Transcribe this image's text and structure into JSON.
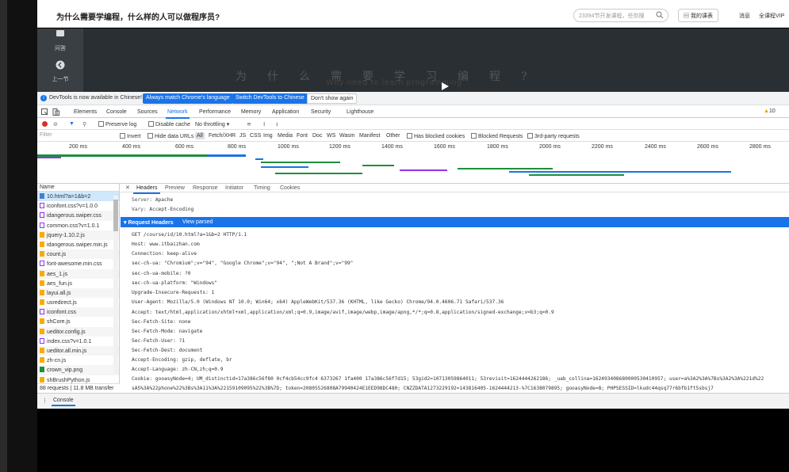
{
  "site": {
    "title": "为什么需要学编程，什么样的人可以做程序员?",
    "search_placeholder": "23394节开发课程，任你搜",
    "my_courses": "我的课表",
    "messages": "消息",
    "vip": "全课程VIP"
  },
  "video": {
    "side_items": [
      {
        "label": "问答",
        "icon": "qa-icon"
      },
      {
        "label": "上一节",
        "icon": "prev-icon"
      }
    ],
    "title_cn": "为什么需要学习编程?",
    "title_en": "Why need to learn programming"
  },
  "infobar": {
    "text": "DevTools is now available in Chinese!",
    "btn_match": "Always match Chrome's language",
    "btn_switch": "Switch DevTools to Chinese",
    "btn_dismiss": "Don't show again"
  },
  "devtools": {
    "tabs": [
      "Elements",
      "Console",
      "Sources",
      "Network",
      "Performance",
      "Memory",
      "Application",
      "Security",
      "Lighthouse"
    ],
    "active_tab": "Network",
    "warnings": "10"
  },
  "toolbar": {
    "preserve_log": "Preserve log",
    "disable_cache": "Disable cache",
    "throttling": "No throttling"
  },
  "filter": {
    "placeholder": "Filter",
    "invert": "Invert",
    "hide_data_urls": "Hide data URLs",
    "types": [
      "All",
      "Fetch/XHR",
      "JS",
      "CSS",
      "Img",
      "Media",
      "Font",
      "Doc",
      "WS",
      "Wasm",
      "Manifest",
      "Other"
    ],
    "has_blocked_cookies": "Has blocked cookies",
    "blocked_requests": "Blocked Requests",
    "third_party": "3rd-party requests"
  },
  "timeline": {
    "ticks": [
      "200 ms",
      "400 ms",
      "600 ms",
      "800 ms",
      "1000 ms",
      "1200 ms",
      "1400 ms",
      "1600 ms",
      "1800 ms",
      "2000 ms",
      "2200 ms",
      "2400 ms",
      "2600 ms",
      "2800 ms"
    ]
  },
  "requests": {
    "header": "Name",
    "rows": [
      {
        "name": "10.html?a=1&b=2",
        "kind": "doc"
      },
      {
        "name": "iconfont.css?v=1.0.0",
        "kind": "css"
      },
      {
        "name": "idangerous.swiper.css",
        "kind": "css"
      },
      {
        "name": "common.css?v=1.0.1",
        "kind": "css"
      },
      {
        "name": "jquery-1.10.2.js",
        "kind": "js"
      },
      {
        "name": "idangerous.swiper.min.js",
        "kind": "js"
      },
      {
        "name": "count.js",
        "kind": "js"
      },
      {
        "name": "font-awesome.min.css",
        "kind": "css"
      },
      {
        "name": "aes_1.js",
        "kind": "js"
      },
      {
        "name": "aes_fun.js",
        "kind": "js"
      },
      {
        "name": "layui.all.js",
        "kind": "js"
      },
      {
        "name": "usredirect.js",
        "kind": "js"
      },
      {
        "name": "iconfont.css",
        "kind": "css"
      },
      {
        "name": "shCore.js",
        "kind": "js"
      },
      {
        "name": "ueditor.config.js",
        "kind": "js"
      },
      {
        "name": "index.css?v=1.0.1",
        "kind": "css"
      },
      {
        "name": "ueditor.all.min.js",
        "kind": "js"
      },
      {
        "name": "zh-cn.js",
        "kind": "js"
      },
      {
        "name": "crown_vip.png",
        "kind": "img"
      },
      {
        "name": "shBrushPython.js",
        "kind": "js"
      }
    ],
    "summary": "88 requests | 11.8 MB transfer"
  },
  "details": {
    "tabs": [
      "Headers",
      "Preview",
      "Response",
      "Initiator",
      "Timing",
      "Cookies"
    ],
    "active": "Headers",
    "response_headers": [
      {
        "k": "Server:",
        "v": "Apache"
      },
      {
        "k": "Vary:",
        "v": "Accept-Encoding"
      }
    ],
    "request_section": "Request Headers",
    "view_parsed": "View parsed",
    "request_lines": [
      "GET /course/id/10.html?a=1&b=2 HTTP/1.1",
      "Host: www.itbaizhan.com",
      "Connection: keep-alive",
      "sec-ch-ua: \"Chromium\";v=\"94\", \"Google Chrome\";v=\"94\", \";Not A Brand\";v=\"99\"",
      "sec-ch-ua-mobile: ?0",
      "sec-ch-ua-platform: \"Windows\"",
      "Upgrade-Insecure-Requests: 1",
      "User-Agent: Mozilla/5.0 (Windows NT 10.0; Win64; x64) AppleWebKit/537.36 (KHTML, like Gecko) Chrome/94.0.4606.71 Safari/537.36",
      "Accept: text/html,application/xhtml+xml,application/xml;q=0.9,image/avif,image/webp,image/apng,*/*;q=0.8,application/signed-exchange;v=b3;q=0.9",
      "Sec-Fetch-Site: none",
      "Sec-Fetch-Mode: navigate",
      "Sec-Fetch-User: ?1",
      "Sec-Fetch-Dest: document",
      "Accept-Encoding: gzip, deflate, br",
      "Accept-Language: zh-CN,zh;q=0.9",
      "Cookie: gooasyNode=4; UM_distinctid=17a386c56f80 0cf4cb54cc9fc4 6373267 1fa400 17a386c56f7d15; 53gid2=10713059864011; 53revisit=1624444262186; _uab_collina=162493408680000530410957; user=a%3A2%3A%7Bs%3A2%3A%221d%22",
      "sA5%3A%22phone%22%3Bs%3A11%3A%22159109095%22%3B%7D; token=20805526808A79940424E1EED98DC480; CNZZDATA1273229192=143816405-1624444213-%7C1638079895; gooasyNode=8; PHPSESSID=lkudc44qsq77r6bfb1ft5sbsj7"
    ]
  },
  "drawer": {
    "tab": "Console"
  }
}
